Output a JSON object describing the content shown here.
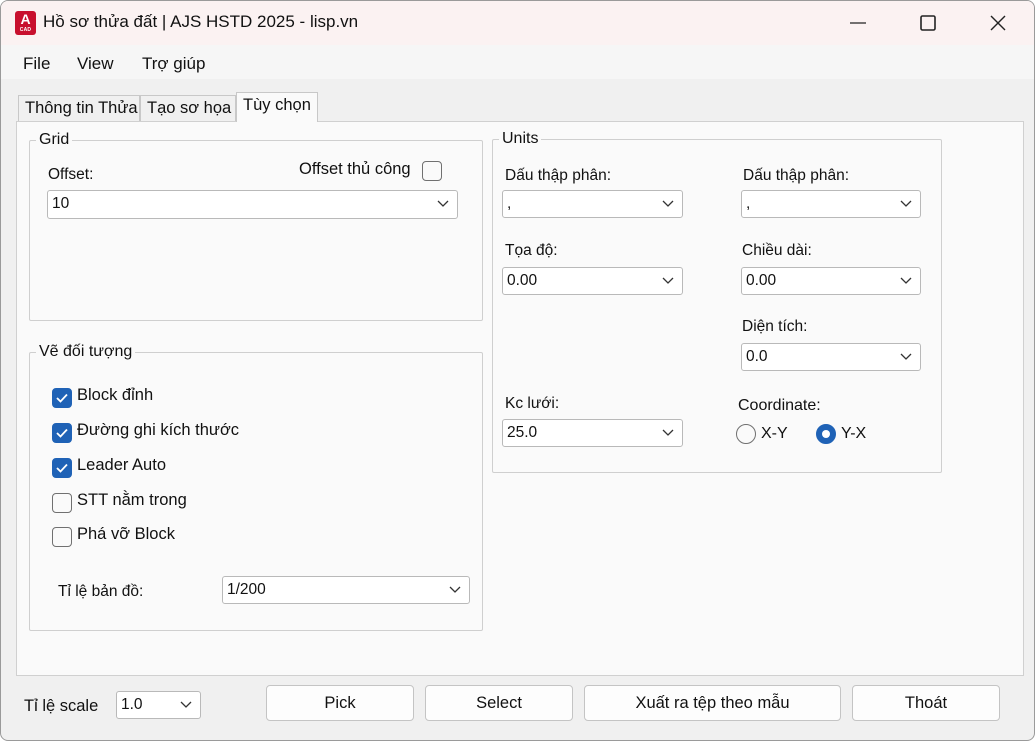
{
  "window": {
    "title": "Hồ sơ thửa đất | AJS HSTD 2025 - lisp.vn",
    "app_icon_letter": "A",
    "app_icon_sub": "CAD"
  },
  "menu": {
    "items": [
      "File",
      "View",
      "Trợ giúp"
    ]
  },
  "tabs": [
    {
      "label": "Thông tin Thửa",
      "active": false
    },
    {
      "label": "Tạo sơ họa",
      "active": false
    },
    {
      "label": "Tùy chọn",
      "active": true
    }
  ],
  "grid": {
    "title": "Grid",
    "offset_label": "Offset:",
    "offset_value": "10",
    "manual_offset_label": "Offset thủ công",
    "manual_offset_checked": false
  },
  "draw_objects": {
    "title": "Vẽ đối tượng",
    "options": [
      {
        "label": "Block đỉnh",
        "checked": true
      },
      {
        "label": "Đường ghi kích thước",
        "checked": true
      },
      {
        "label": "Leader Auto",
        "checked": true
      },
      {
        "label": "STT nằm trong",
        "checked": false
      },
      {
        "label": "Phá vỡ Block",
        "checked": false
      }
    ],
    "map_scale_label": "Tỉ lệ bản đồ:",
    "map_scale_value": "1/200"
  },
  "units": {
    "title": "Units",
    "decimal_sep_left_label": "Dấu thập phân:",
    "decimal_sep_left_value": ",",
    "decimal_sep_right_label": "Dấu thập phân:",
    "decimal_sep_right_value": ",",
    "coordinate_format_label": "Tọa độ:",
    "coordinate_format_value": "0.00",
    "length_label": "Chiều dài:",
    "length_value": "0.00",
    "area_label": "Diện tích:",
    "area_value": "0.0",
    "grid_spacing_label": "Kc lưới:",
    "grid_spacing_value": "25.0",
    "coordinate_label": "Coordinate:",
    "coordinate_options": [
      {
        "label": "X-Y",
        "selected": false
      },
      {
        "label": "Y-X",
        "selected": true
      }
    ]
  },
  "footer": {
    "scale_label": "Tỉ lệ scale",
    "scale_value": "1.0",
    "pick_label": "Pick",
    "select_label": "Select",
    "export_label": "Xuất ra tệp theo mẫu",
    "exit_label": "Thoát"
  },
  "colors": {
    "accent": "#1f62b6",
    "title_bar": "#fbf2f2",
    "app_icon": "#c8102e"
  }
}
